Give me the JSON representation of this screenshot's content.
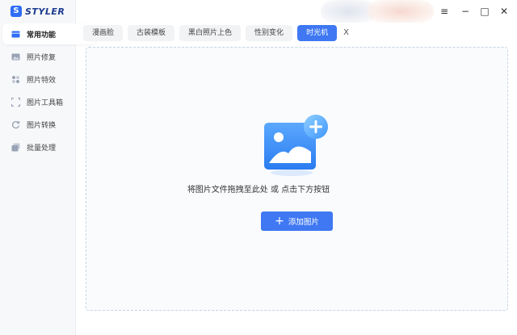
{
  "app": {
    "logo_letter": "S",
    "name": "STYLER"
  },
  "sidebar": {
    "items": [
      {
        "label": "常用功能",
        "icon": "card-icon",
        "active": true
      },
      {
        "label": "照片修复",
        "icon": "image-repair-icon",
        "active": false
      },
      {
        "label": "照片特效",
        "icon": "sparkle-icon",
        "active": false
      },
      {
        "label": "图片工具箱",
        "icon": "crop-frame-icon",
        "active": false
      },
      {
        "label": "图片转换",
        "icon": "convert-icon",
        "active": false
      },
      {
        "label": "批量处理",
        "icon": "stack-icon",
        "active": false
      }
    ]
  },
  "window": {
    "menu": "≡",
    "minimize": "−",
    "maximize": "□",
    "close": "✕"
  },
  "tabs": [
    {
      "label": "漫画脸",
      "active": false
    },
    {
      "label": "古装模板",
      "active": false
    },
    {
      "label": "黑白照片上色",
      "active": false
    },
    {
      "label": "性别变化",
      "active": false
    },
    {
      "label": "时光机",
      "active": true
    }
  ],
  "tab_close": "X",
  "dropzone": {
    "hint": "将图片文件拖拽至此处 或 点击下方按钮",
    "button_label": "添加图片",
    "button_icon": "+"
  },
  "colors": {
    "accent": "#3f78f2",
    "sidebar_bg": "#f7f8fa"
  }
}
